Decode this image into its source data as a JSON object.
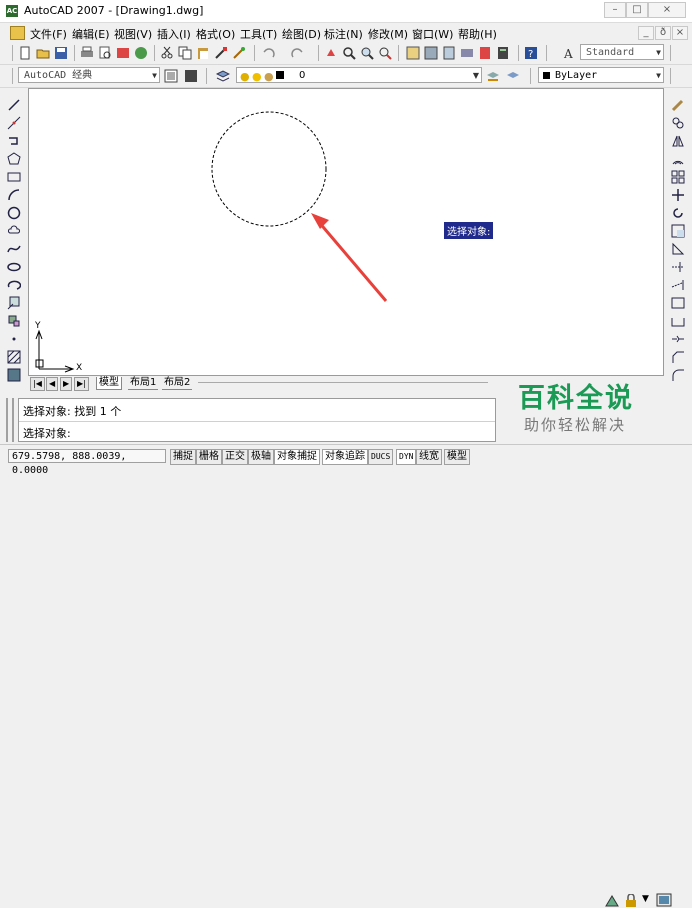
{
  "window": {
    "title": "AutoCAD 2007 - [Drawing1.dwg]",
    "app_icon_text": "AC",
    "controls": [
      "–",
      "□",
      "×"
    ]
  },
  "menubar": {
    "items": [
      "文件(F)",
      "编辑(E)",
      "视图(V)",
      "插入(I)",
      "格式(O)",
      "工具(T)",
      "绘图(D)",
      "标注(N)",
      "修改(M)",
      "窗口(W)",
      "帮助(H)"
    ],
    "doc_controls": [
      "_",
      "ð",
      "×"
    ]
  },
  "toolbar": {
    "text_style": "Standard",
    "workspace": "AutoCAD 经典",
    "layer": "0",
    "color": "ByLayer"
  },
  "canvas": {
    "tooltip": "选择对象:",
    "ucs_x": "X",
    "ucs_y": "Y",
    "colors": {
      "circle": "#000000",
      "arrow": "#e8403a"
    }
  },
  "tabs": {
    "nav": [
      "|◀",
      "◀",
      "▶",
      "▶|"
    ],
    "items": [
      "模型",
      "布局1",
      "布局2"
    ]
  },
  "command": {
    "line1": "选择对象: 找到 1 个",
    "line2": "选择对象:"
  },
  "status": {
    "coords": "679.5798, 888.0039, 0.0000",
    "buttons": [
      "捕捉",
      "栅格",
      "正交",
      "极轴",
      "对象捕捉",
      "对象追踪",
      "DUCS",
      "DYN",
      "线宽",
      "模型"
    ]
  },
  "watermark": {
    "title": "百科全说",
    "subtitle": "助你轻松解决"
  }
}
